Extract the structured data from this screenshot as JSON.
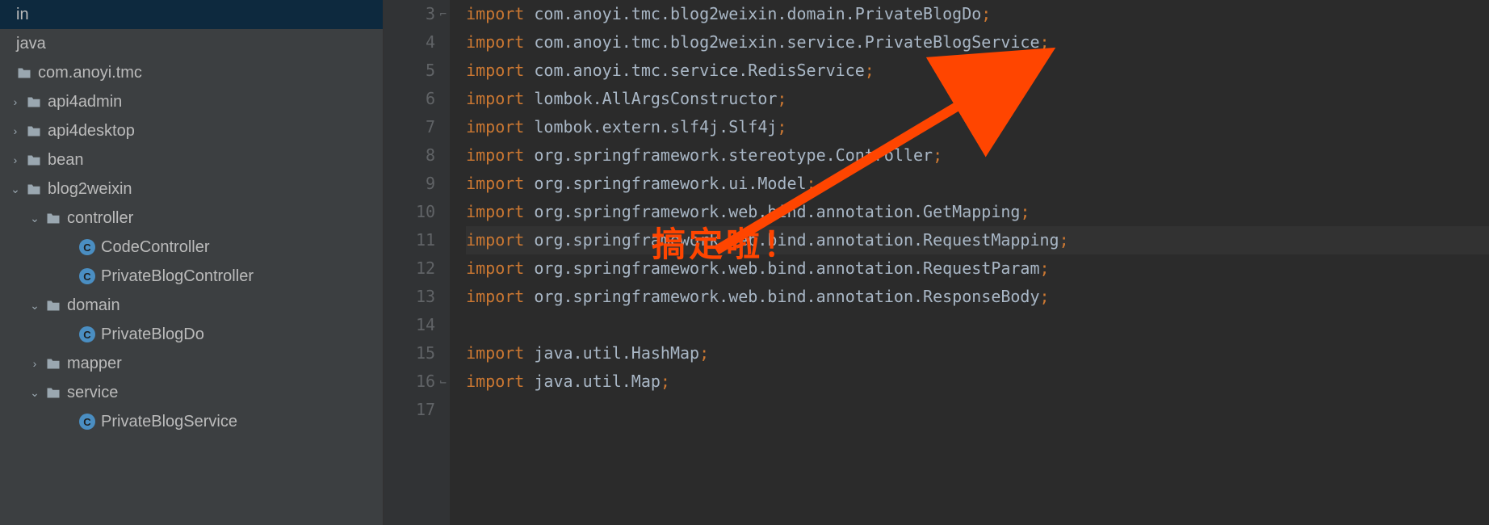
{
  "sidebar": {
    "rows": [
      {
        "indent": 0,
        "arrow": "",
        "icon": "none",
        "label": "in"
      },
      {
        "indent": 0,
        "arrow": "",
        "icon": "none",
        "label": "java"
      },
      {
        "indent": 0,
        "arrow": "",
        "icon": "folder",
        "label": "com.anoyi.tmc"
      },
      {
        "indent": 12,
        "arrow": "›",
        "icon": "folder",
        "label": "api4admin"
      },
      {
        "indent": 12,
        "arrow": "›",
        "icon": "folder",
        "label": "api4desktop"
      },
      {
        "indent": 12,
        "arrow": "›",
        "icon": "folder",
        "label": "bean"
      },
      {
        "indent": 12,
        "arrow": "⌄",
        "icon": "folder",
        "label": "blog2weixin"
      },
      {
        "indent": 36,
        "arrow": "⌄",
        "icon": "folder",
        "label": "controller"
      },
      {
        "indent": 78,
        "arrow": "",
        "icon": "class",
        "label": "CodeController"
      },
      {
        "indent": 78,
        "arrow": "",
        "icon": "class",
        "label": "PrivateBlogController"
      },
      {
        "indent": 36,
        "arrow": "⌄",
        "icon": "folder",
        "label": "domain"
      },
      {
        "indent": 78,
        "arrow": "",
        "icon": "class",
        "label": "PrivateBlogDo"
      },
      {
        "indent": 36,
        "arrow": "›",
        "icon": "folder",
        "label": "mapper"
      },
      {
        "indent": 36,
        "arrow": "⌄",
        "icon": "folder",
        "label": "service"
      },
      {
        "indent": 78,
        "arrow": "",
        "icon": "class",
        "label": "PrivateBlogService"
      }
    ]
  },
  "editor": {
    "startLine": 3,
    "currentLine": 11,
    "foldOpenLines": [
      3
    ],
    "foldCloseLines": [
      16
    ],
    "lines": [
      {
        "n": 3,
        "kw": "import",
        "rest": " com.anoyi.tmc.blog2weixin.domain.PrivateBlogDo",
        "semi": ";"
      },
      {
        "n": 4,
        "kw": "import",
        "rest": " com.anoyi.tmc.blog2weixin.service.PrivateBlogService",
        "semi": ";"
      },
      {
        "n": 5,
        "kw": "import",
        "rest": " com.anoyi.tmc.service.RedisService",
        "semi": ";"
      },
      {
        "n": 6,
        "kw": "import",
        "rest": " lombok.AllArgsConstructor",
        "semi": ";"
      },
      {
        "n": 7,
        "kw": "import",
        "rest": " lombok.extern.slf4j.Slf4j",
        "semi": ";"
      },
      {
        "n": 8,
        "kw": "import",
        "rest": " org.springframework.stereotype.Controller",
        "semi": ";"
      },
      {
        "n": 9,
        "kw": "import",
        "rest": " org.springframework.ui.Model",
        "semi": ";"
      },
      {
        "n": 10,
        "kw": "import",
        "rest": " org.springframework.web.bind.annotation.GetMapping",
        "semi": ";"
      },
      {
        "n": 11,
        "kw": "import",
        "rest": " org.springframework.web.bind.annotation.RequestMapping",
        "semi": ";"
      },
      {
        "n": 12,
        "kw": "import",
        "rest": " org.springframework.web.bind.annotation.RequestParam",
        "semi": ";"
      },
      {
        "n": 13,
        "kw": "import",
        "rest": " org.springframework.web.bind.annotation.ResponseBody",
        "semi": ";"
      },
      {
        "n": 14,
        "kw": "",
        "rest": "",
        "semi": ""
      },
      {
        "n": 15,
        "kw": "import",
        "rest": " java.util.HashMap",
        "semi": ";"
      },
      {
        "n": 16,
        "kw": "import",
        "rest": " java.util.Map",
        "semi": ";"
      },
      {
        "n": 17,
        "kw": "",
        "rest": "",
        "semi": ""
      }
    ]
  },
  "annotation": {
    "text": "搞定啦！",
    "color": "#ff4500"
  }
}
